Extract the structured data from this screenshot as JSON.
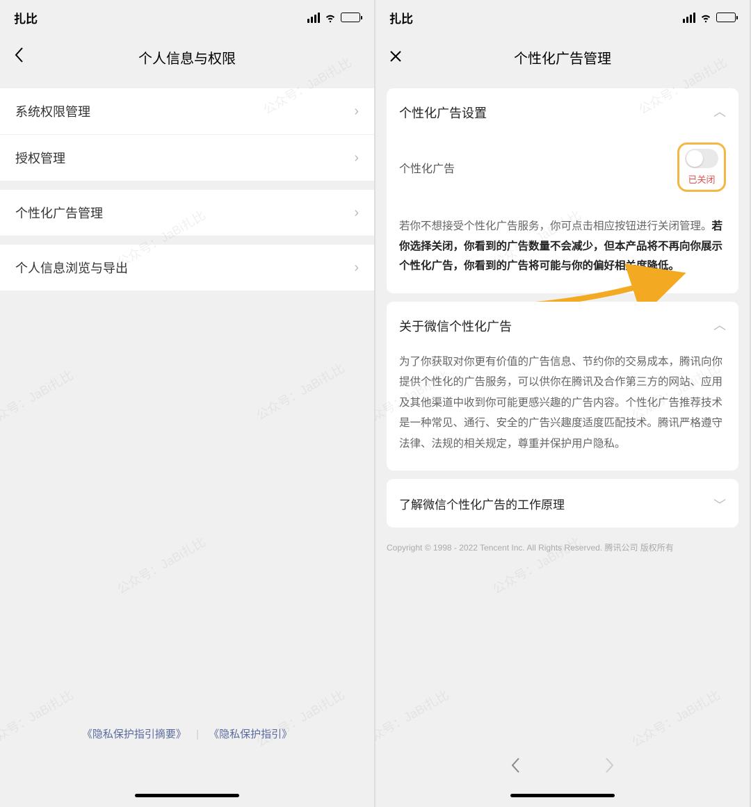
{
  "statusBar": {
    "carrier": "扎比"
  },
  "left": {
    "title": "个人信息与权限",
    "items": [
      "系统权限管理",
      "授权管理",
      "个性化广告管理",
      "个人信息浏览与导出"
    ],
    "links": {
      "a": "《隐私保护指引摘要》",
      "b": "《隐私保护指引》"
    }
  },
  "right": {
    "title": "个性化广告管理",
    "section1": {
      "header": "个性化广告设置",
      "toggleLabel": "个性化广告",
      "offText": "已关闭",
      "descPlain": "若你不想接受个性化广告服务，你可点击相应按钮进行关闭管理。",
      "descBold": "若你选择关闭，你看到的广告数量不会减少，但本产品将不再向你展示个性化广告，你看到的广告将可能与你的偏好相关度降低。"
    },
    "section2": {
      "header": "关于微信个性化广告",
      "body": "为了你获取对你更有价值的广告信息、节约你的交易成本，腾讯向你提供个性化的广告服务，可以供你在腾讯及合作第三方的网站、应用及其他渠道中收到你可能更感兴趣的广告内容。个性化广告推荐技术是一种常见、通行、安全的广告兴趣度适度匹配技术。腾讯严格遵守法律、法规的相关规定，尊重并保护用户隐私。"
    },
    "section3": {
      "header": "了解微信个性化广告的工作原理"
    },
    "copyright": "Copyright © 1998 - 2022 Tencent Inc. All Rights Reserved. 腾讯公司 版权所有"
  },
  "watermark": "公众号：JaBi扎比"
}
